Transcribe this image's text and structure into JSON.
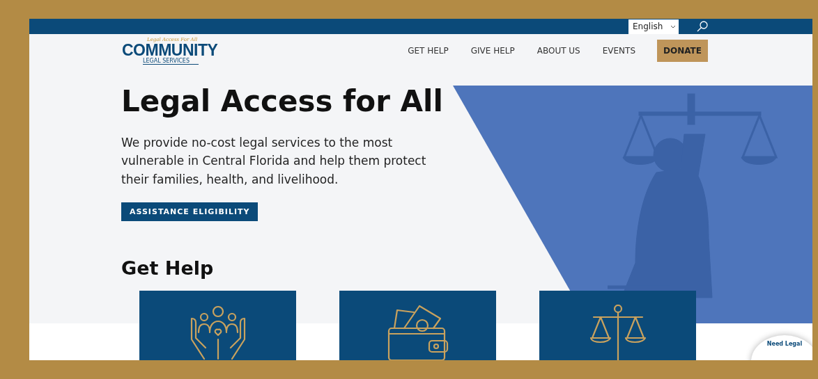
{
  "top_bar": {
    "language": "English"
  },
  "logo": {
    "tagline": "Legal Access For All",
    "name": "COMMUNITY",
    "subtitle": "LEGAL SERVICES"
  },
  "nav": {
    "items": [
      "GET HELP",
      "GIVE HELP",
      "ABOUT US",
      "EVENTS"
    ],
    "donate": "DONATE"
  },
  "hero": {
    "title": "Legal Access for All",
    "text": "We provide no-cost legal services to the most vulnerable in Central Florida and help them protect their families, health, and livelihood.",
    "button": "ASSISTANCE ELIGIBILITY"
  },
  "get_help": {
    "title": "Get Help",
    "cards": [
      {
        "kind": "family"
      },
      {
        "kind": "wallet"
      },
      {
        "kind": "scales"
      }
    ]
  },
  "chat_badge": {
    "text": "Need Legal"
  }
}
